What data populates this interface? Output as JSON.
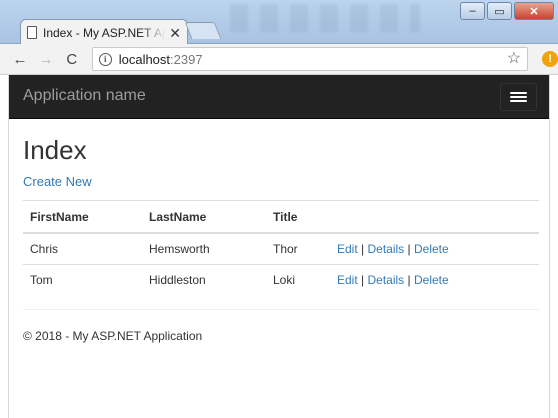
{
  "browser": {
    "tab": {
      "title": "Index - My ASP.NET Application",
      "close_glyph": "✕"
    },
    "window_controls": {
      "minimize": "–",
      "maximize": "▭",
      "close": "✕"
    },
    "toolbar": {
      "url_host": "localhost",
      "url_port": ":2397",
      "back_glyph": "←",
      "forward_glyph": "→",
      "reload_glyph": "C",
      "star_glyph": "☆",
      "info_glyph": "i",
      "extension_glyph": "!"
    }
  },
  "page": {
    "navbar": {
      "brand": "Application name"
    },
    "title": "Index",
    "create_link": "Create New",
    "table": {
      "headers": [
        "FirstName",
        "LastName",
        "Title",
        ""
      ],
      "rows": [
        {
          "first": "Chris",
          "last": "Hemsworth",
          "title": "Thor"
        },
        {
          "first": "Tom",
          "last": "Hiddleston",
          "title": "Loki"
        }
      ],
      "actions": {
        "edit": "Edit",
        "details": "Details",
        "delete": "Delete",
        "separator": "|"
      }
    },
    "footer": "© 2018 - My ASP.NET Application"
  },
  "colors": {
    "navbar": "#222222",
    "link": "#337ab7",
    "brand_text": "#9d9d9d"
  }
}
